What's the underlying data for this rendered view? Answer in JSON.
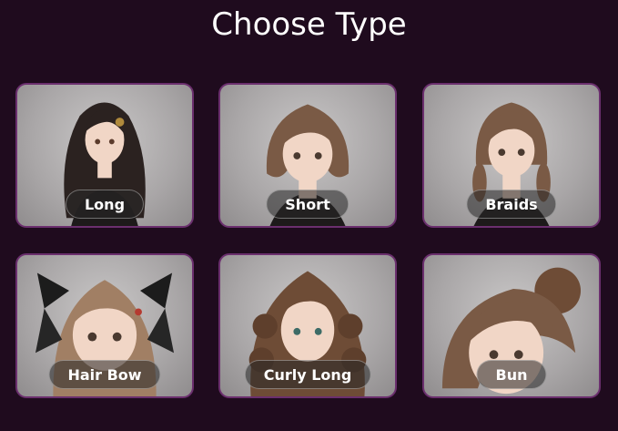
{
  "title": "Choose Type",
  "options": [
    {
      "label": "Long"
    },
    {
      "label": "Short"
    },
    {
      "label": "Braids"
    },
    {
      "label": "Hair Bow"
    },
    {
      "label": "Curly Long"
    },
    {
      "label": "Bun"
    }
  ],
  "colors": {
    "background": "#1f0b1e",
    "card_border": "#6b2f6e",
    "hair_dark": "#2b2220",
    "hair_brown": "#7a5a45",
    "skin": "#f1d6c6"
  }
}
